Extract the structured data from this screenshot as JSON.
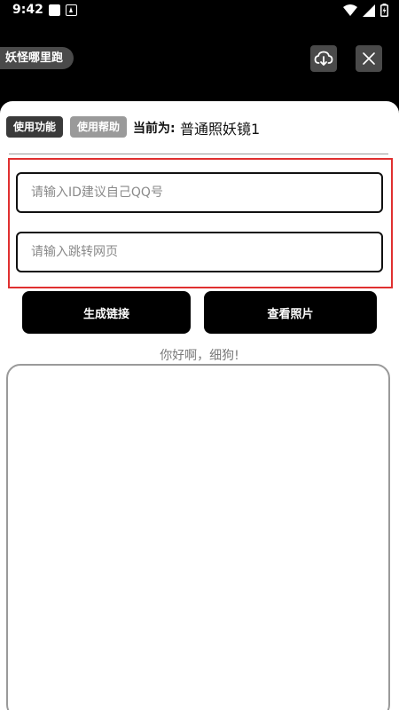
{
  "status_bar": {
    "time": "9:42",
    "icons": [
      "image-notification-icon",
      "font-notification-icon",
      "wifi-icon",
      "signal-icon",
      "battery-icon"
    ]
  },
  "header": {
    "title": "妖怪哪里跑",
    "buttons": [
      "cloud-download-icon",
      "close-icon"
    ]
  },
  "tabs": {
    "use_label": "使用功能",
    "help_label": "使用帮助"
  },
  "current": {
    "label": "当前为:",
    "value": "普通照妖镜1"
  },
  "inputs": {
    "id_placeholder": "请输入ID建议自己QQ号",
    "url_placeholder": "请输入跳转网页"
  },
  "actions": {
    "generate_label": "生成链接",
    "view_label": "查看照片"
  },
  "greeting": "你好啊，细狗!",
  "colors": {
    "highlight_border": "#e03030",
    "button_bg": "#000000",
    "tab_active": "#3a3a3a",
    "tab_inactive": "#9a9a9a"
  }
}
